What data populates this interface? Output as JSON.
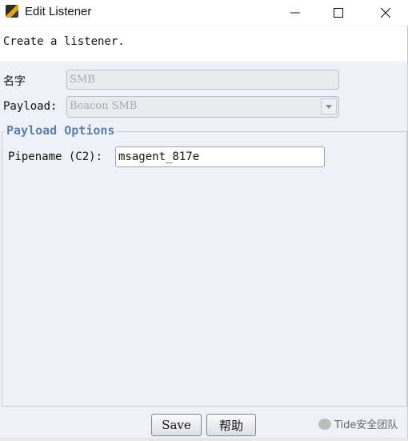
{
  "window": {
    "title": "Edit Listener",
    "icon": "cobalt-strike-app-icon",
    "controls": [
      "minimize-icon",
      "maximize-icon",
      "close-icon"
    ]
  },
  "header": {
    "message": "Create a listener."
  },
  "form": {
    "name_label": "名字",
    "name_value": "SMB",
    "payload_label": "Payload:",
    "payload_value": "Beacon SMB"
  },
  "payload_options": {
    "title": "Payload Options",
    "pipename_label": "Pipename (C2):",
    "pipename_value": "msagent_817e"
  },
  "buttons": {
    "save": "Save",
    "help": "帮助"
  },
  "watermark": {
    "text": "Tide安全团队"
  }
}
